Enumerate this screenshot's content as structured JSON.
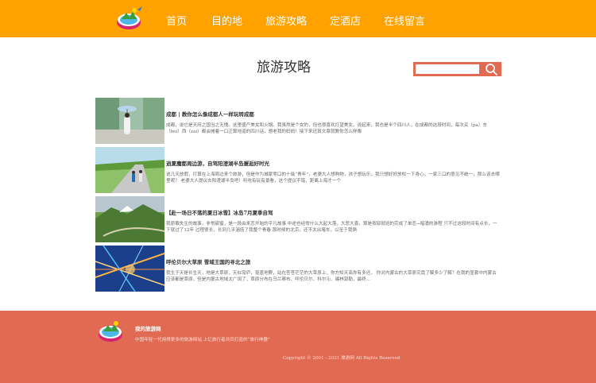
{
  "nav": {
    "items": [
      "首页",
      "目的地",
      "旅游攻略",
      "定酒店",
      "在线留言"
    ]
  },
  "page": {
    "title": "旅游攻略"
  },
  "search": {
    "placeholder": ""
  },
  "articles": [
    {
      "title": "成都 | 教你怎么像成都人一样玩转成都",
      "desc": "成都，说它是天府之国当之无愧。这里盛产美女和火锅。我虽然是个女的，但也很喜欢打望美女。说起来，我也是半个四川人，在成都的这段时间，每次买（pa）东（bei）西（zai）都会摊着一口正算地道的四川话，想老我的妈妈！接下来还真文章就教你怎么样像"
    },
    {
      "title": "逍夏魔都周边游，自驾阳澄湖半岛邂逅好时光",
      "desc": "说几天放假，打算在上海周边来个旅游，但是作为城家零口的十级“青年”，老婆大人想购物，孩子想玩乐，我只想好好放松一下身心，一家三口的意见不统一，那么该去哪里呢？ 老婆大人提议去阳澄湖半岛吧！听吃有玩有景看，这个提议不错，距离上海才一个"
    },
    {
      "title": "【赴一场日不落的夏日冰雪】冰岛7月夏季自驾",
      "desc": "我原载失生的故事，非常甜蜜，是一段由来恋开始的平凡故事 中途也经常什么大起大落，大悲大喜，算是按部就班的完成了单恋→暗涌的游程 只不过这段时间有点长，一下就过了12年 过程很长，长到几乎涵括了我整个青春 那时候的北京，还不太出堵车，以至于我俩"
    },
    {
      "title": "呼伦贝尔大草原 雪域王国的寻北之旅",
      "desc": "我生于天是长生天，地是大草原，天似穹庐，笼盖地野，站在苍苍茫茫的大草原上，你方知天高你有多还， 你对内蒙古的大草原究竟了解多少了解？在我的显套中内蒙古应该都是草原，但是内蒙古地域太广阔了，草原分布在乌兰察布、呼伦贝尔、科尔沁、锡林郭勒，最终..."
    }
  ],
  "footer": {
    "site_name": "我的旅游网",
    "slogan": "中国年轻一代用得更多的旅游网站 上亿旅行者共同打造的“旅行神器”",
    "copyright": "Copyright © 2001 - 2021 旅游网 All Rights Reserved"
  },
  "colors": {
    "header": "#ffa200",
    "footer": "#e06a52",
    "accent": "#e06a52"
  },
  "icons": {
    "logo": "travel-logo-icon",
    "search": "search-icon"
  }
}
